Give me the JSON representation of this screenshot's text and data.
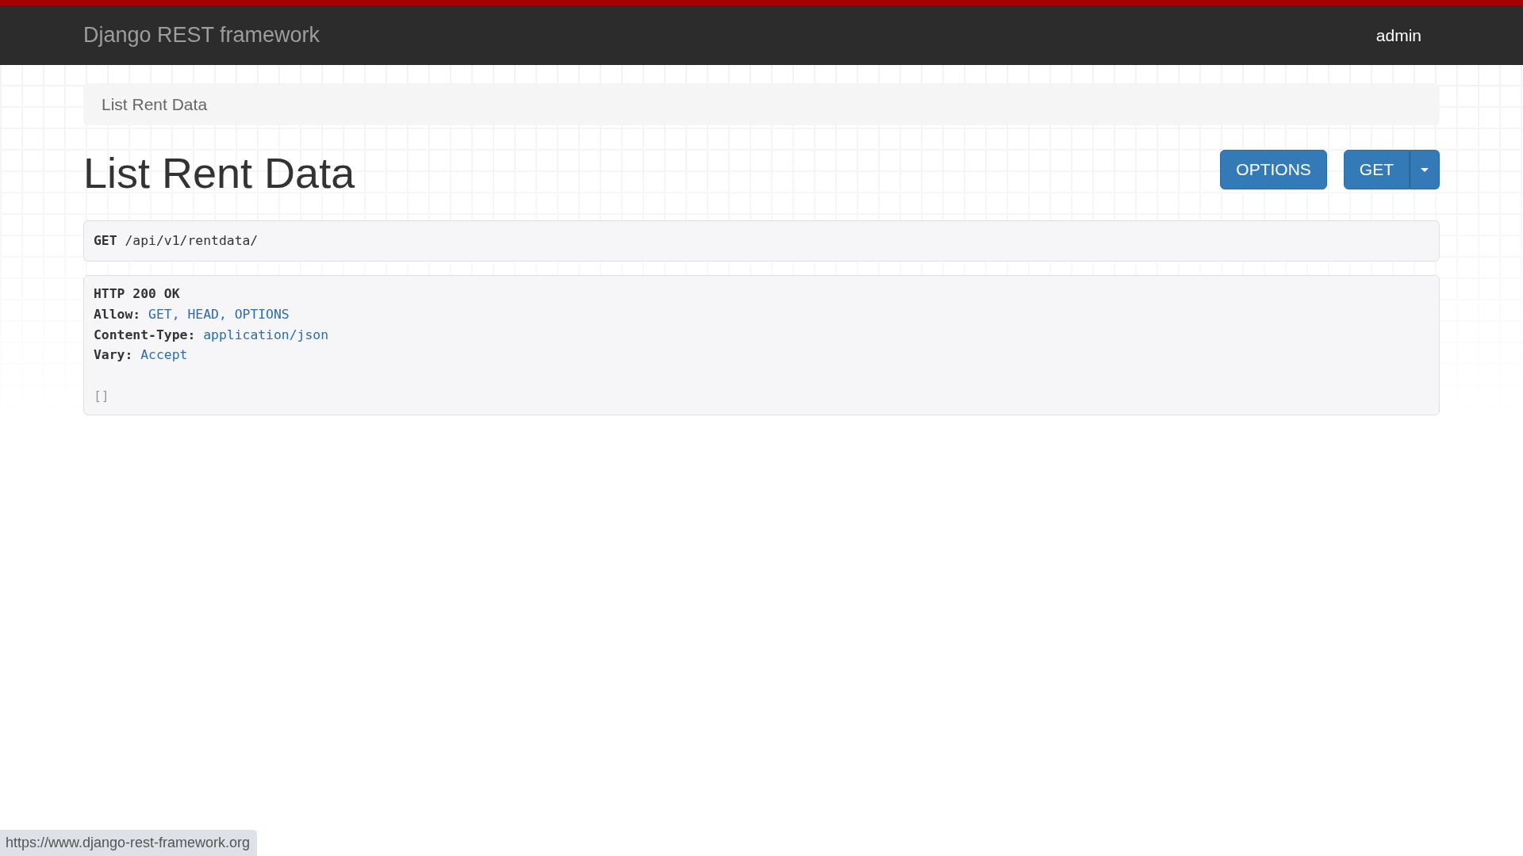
{
  "navbar": {
    "brand": "Django REST framework",
    "user": "admin"
  },
  "breadcrumb": [
    "List Rent Data"
  ],
  "page": {
    "title": "List Rent Data",
    "buttons": [
      {
        "label": "OPTIONS",
        "kind": "button"
      },
      {
        "label": "GET",
        "kind": "split"
      }
    ]
  },
  "request": {
    "method": "GET",
    "path": "/api/v1/rentdata/"
  },
  "response": {
    "status": "HTTP 200 OK",
    "headers": [
      {
        "name": "Allow:",
        "value": "GET, HEAD, OPTIONS"
      },
      {
        "name": "Content-Type:",
        "value": "application/json"
      },
      {
        "name": "Vary:",
        "value": "Accept"
      }
    ],
    "body": "[]"
  },
  "status_bar": {
    "url": "https://www.django-rest-framework.org"
  }
}
